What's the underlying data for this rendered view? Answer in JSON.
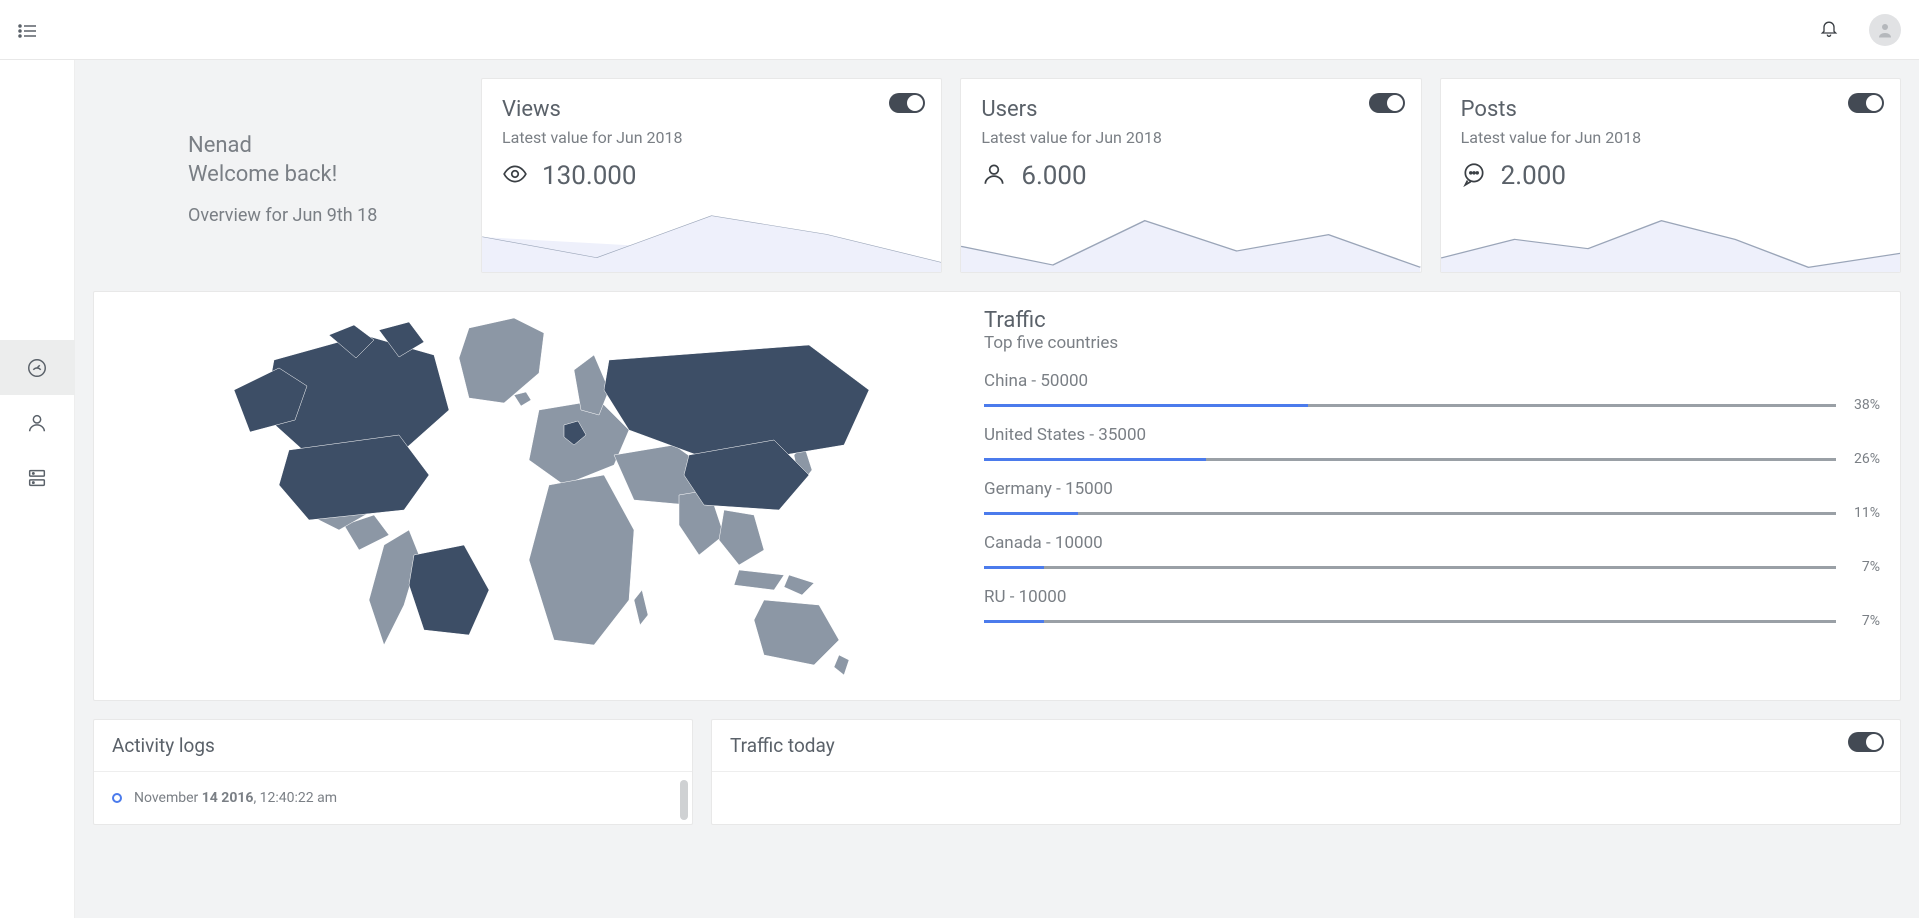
{
  "topbar": {
    "icons": {
      "menu": "menu",
      "bell": "bell",
      "avatar": "avatar"
    }
  },
  "sidebar": {
    "items": [
      {
        "name": "dashboard",
        "active": true
      },
      {
        "name": "user",
        "active": false
      },
      {
        "name": "server",
        "active": false
      }
    ]
  },
  "welcome": {
    "name": "Nenad",
    "greeting": "Welcome back!",
    "overview": "Overview for Jun 9th 18"
  },
  "stats": [
    {
      "title": "Views",
      "subtitle": "Latest value for Jun 2018",
      "value": "130.000",
      "icon": "eye",
      "toggle": true
    },
    {
      "title": "Users",
      "subtitle": "Latest value for Jun 2018",
      "value": "6.000",
      "icon": "user",
      "toggle": true
    },
    {
      "title": "Posts",
      "subtitle": "Latest value for Jun 2018",
      "value": "2.000",
      "icon": "chat",
      "toggle": true
    }
  ],
  "traffic": {
    "title": "Traffic",
    "subtitle": "Top five countries",
    "countries": [
      {
        "name": "China",
        "value": "50000",
        "pct": "38%"
      },
      {
        "name": "United States",
        "value": "35000",
        "pct": "26%"
      },
      {
        "name": "Germany",
        "value": "15000",
        "pct": "11%"
      },
      {
        "name": "Canada",
        "value": "10000",
        "pct": "7%"
      },
      {
        "name": "RU",
        "value": "10000",
        "pct": "7%"
      }
    ]
  },
  "activity": {
    "title": "Activity logs",
    "items": [
      {
        "date_prefix": "November ",
        "date_bold": "14 2016",
        "time": ", 12:40:22 am"
      }
    ]
  },
  "today": {
    "title": "Traffic today",
    "toggle": true
  },
  "chart_data": [
    {
      "type": "area",
      "title": "Views sparkline",
      "x": [
        0,
        1,
        2,
        3,
        4
      ],
      "values": [
        50,
        20,
        60,
        35,
        12
      ]
    },
    {
      "type": "area",
      "title": "Users sparkline",
      "x": [
        0,
        1,
        2,
        3,
        4,
        5
      ],
      "values": [
        35,
        10,
        55,
        30,
        50,
        8
      ]
    },
    {
      "type": "area",
      "title": "Posts sparkline",
      "x": [
        0,
        1,
        2,
        3,
        4,
        5,
        6
      ],
      "values": [
        20,
        40,
        30,
        55,
        35,
        10,
        25
      ]
    },
    {
      "type": "bar",
      "title": "Traffic — Top five countries",
      "categories": [
        "China",
        "United States",
        "Germany",
        "Canada",
        "RU"
      ],
      "values": [
        50000,
        35000,
        15000,
        10000,
        10000
      ],
      "percentages": [
        38,
        26,
        11,
        7,
        7
      ]
    }
  ],
  "colors": {
    "spark_stroke": "#9aa5b8",
    "spark_fill": "#eef0fb",
    "accent": "#4b7bec",
    "map_base": "#8c97a5",
    "map_highlight": "#3d4e66"
  }
}
